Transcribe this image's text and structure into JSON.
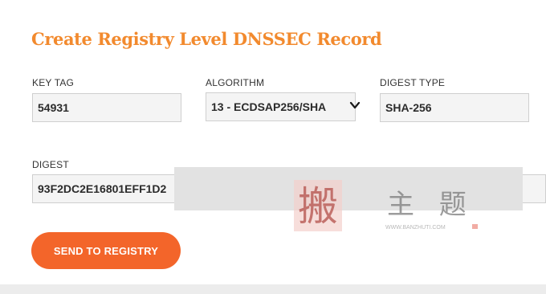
{
  "form": {
    "title": "Create Registry Level DNSSEC Record",
    "key_tag": {
      "label": "KEY TAG",
      "value": "54931"
    },
    "algorithm": {
      "label": "ALGORITHM",
      "selected": "13 - ECDSAP256/SHA"
    },
    "digest_type": {
      "label": "DIGEST TYPE",
      "value": "SHA-256"
    },
    "digest": {
      "label": "DIGEST",
      "value": "93F2DC2E16801EFF1D2"
    },
    "submit_label": "SEND TO REGISTRY"
  },
  "watermark": {
    "glyph": "搬",
    "text": "主 题",
    "url": "WWW.BANZHUTI.COM"
  },
  "colors": {
    "title": "#f28a2e",
    "button": "#f3652a",
    "field_bg": "#f4f4f4"
  },
  "icons": {
    "algorithm_dropdown": "chevron-down-icon"
  }
}
